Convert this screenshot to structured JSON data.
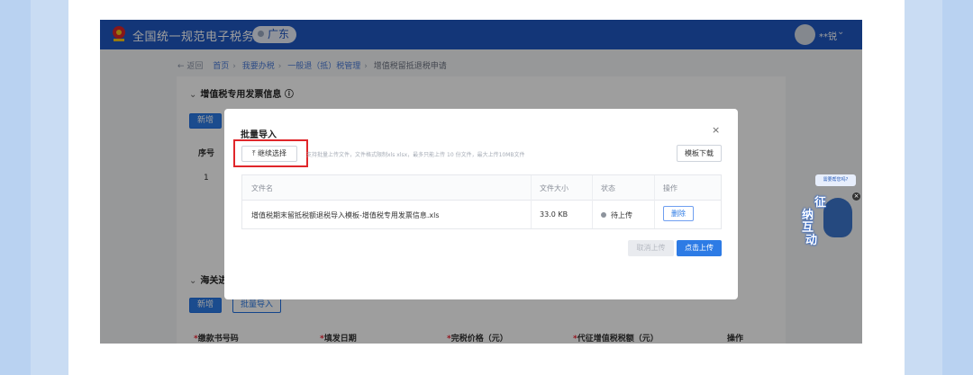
{
  "site": {
    "title": "全国统一规范电子税务局",
    "region": "广东",
    "user_name": "**锐",
    "caret": "⌄"
  },
  "breadcrumb": {
    "back": "← 返回",
    "items": [
      "首页",
      "我要办税",
      "一般退（抵）税管理",
      "增值税留抵退税申请"
    ],
    "separator": "›"
  },
  "section1": {
    "title": "增值税专用发票信息",
    "info_icon": "ⓘ",
    "add_label": "新增",
    "headers": [
      "序号"
    ],
    "row_number": "1"
  },
  "section2": {
    "title": "海关进",
    "add_label": "新增",
    "import_label": "批量导入",
    "headers": [
      "缴款书号码",
      "填发日期",
      "完税价格（元）",
      "代征增值税税额（元）",
      "操作"
    ]
  },
  "mascot": {
    "bubble": "需要帮您吗?",
    "chars": [
      "征",
      "纳",
      "互",
      "动"
    ],
    "close": "×"
  },
  "modal": {
    "title": "批量导入",
    "close": "×",
    "choose_label": "继续选择",
    "hint": "支持批量上传文件，文件格式限制xls xlsx，最多只能上传 10 份文件，最大上传10MB文件",
    "template_label": "模板下载",
    "columns": [
      "文件名",
      "文件大小",
      "状态",
      "操作"
    ],
    "files": [
      {
        "name": "增值税期末留抵税额退税导入模板-增值税专用发票信息.xls",
        "size": "33.0 KB",
        "status": "待上传",
        "action": "删除"
      }
    ],
    "cancel_label": "取消上传",
    "upload_label": "点击上传"
  },
  "colors": {
    "topbar": "#1f57c2",
    "primary": "#2d7be5",
    "highlight": "#e0262a",
    "frame": "#b9d2f1"
  }
}
